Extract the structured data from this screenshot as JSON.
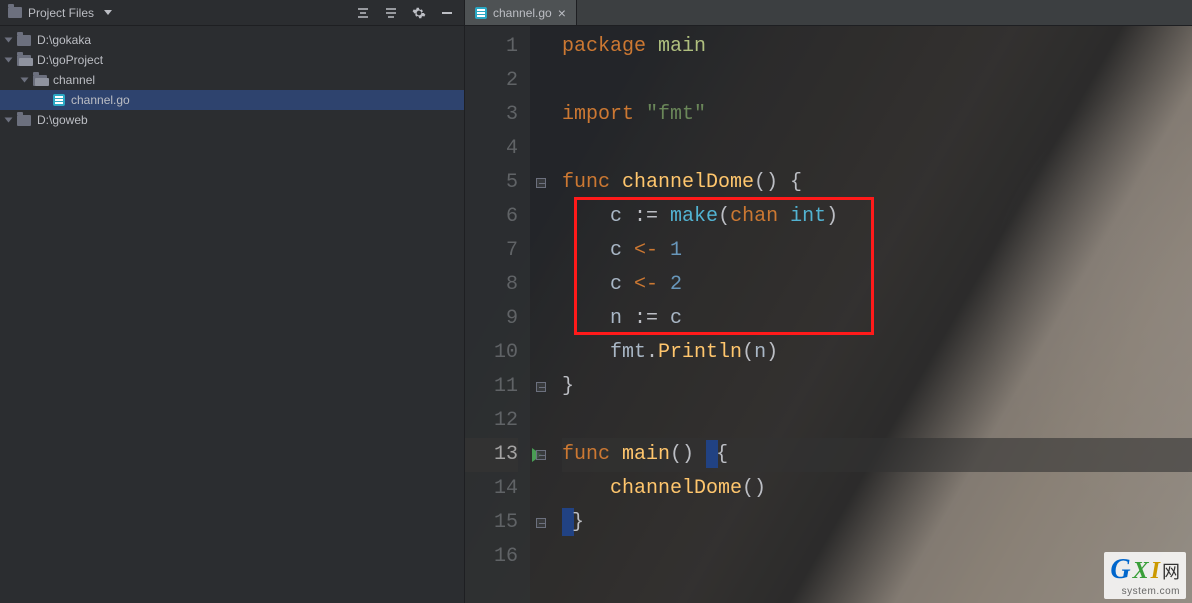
{
  "sidebar": {
    "title": "Project Files",
    "items": [
      {
        "label": "D:\\gokaka",
        "depth": 0,
        "expanded": true,
        "type": "folder",
        "selected": false
      },
      {
        "label": "D:\\goProject",
        "depth": 0,
        "expanded": true,
        "type": "folder-open",
        "selected": false
      },
      {
        "label": "channel",
        "depth": 1,
        "expanded": true,
        "type": "folder-open",
        "selected": false
      },
      {
        "label": "channel.go",
        "depth": 2,
        "expanded": null,
        "type": "go-file",
        "selected": true
      },
      {
        "label": "D:\\goweb",
        "depth": 0,
        "expanded": true,
        "type": "folder",
        "selected": false
      }
    ]
  },
  "tabs": [
    {
      "label": "channel.go",
      "active": true
    }
  ],
  "active_line": 13,
  "code": [
    {
      "n": 1,
      "tokens": [
        {
          "t": "package ",
          "c": "kw"
        },
        {
          "t": "main",
          "c": "pkg"
        }
      ]
    },
    {
      "n": 2,
      "tokens": []
    },
    {
      "n": 3,
      "tokens": [
        {
          "t": "import ",
          "c": "kw"
        },
        {
          "t": "\"fmt\"",
          "c": "str"
        }
      ]
    },
    {
      "n": 4,
      "tokens": []
    },
    {
      "n": 5,
      "tokens": [
        {
          "t": "func ",
          "c": "kw"
        },
        {
          "t": "channelDome",
          "c": "fn"
        },
        {
          "t": "() {",
          "c": "pln"
        }
      ],
      "fold": true
    },
    {
      "n": 6,
      "tokens": [
        {
          "t": "    ",
          "c": "pln"
        },
        {
          "t": "c",
          "c": "ident"
        },
        {
          "t": " := ",
          "c": "pln"
        },
        {
          "t": "make",
          "c": "typ"
        },
        {
          "t": "(",
          "c": "pln"
        },
        {
          "t": "chan ",
          "c": "kw"
        },
        {
          "t": "int",
          "c": "typ"
        },
        {
          "t": ")",
          "c": "pln"
        }
      ]
    },
    {
      "n": 7,
      "tokens": [
        {
          "t": "    ",
          "c": "pln"
        },
        {
          "t": "c",
          "c": "ident"
        },
        {
          "t": " <- ",
          "c": "op"
        },
        {
          "t": "1",
          "c": "num"
        }
      ]
    },
    {
      "n": 8,
      "tokens": [
        {
          "t": "    ",
          "c": "pln"
        },
        {
          "t": "c",
          "c": "ident"
        },
        {
          "t": " <- ",
          "c": "op"
        },
        {
          "t": "2",
          "c": "num"
        }
      ]
    },
    {
      "n": 9,
      "tokens": [
        {
          "t": "    ",
          "c": "pln"
        },
        {
          "t": "n",
          "c": "ident"
        },
        {
          "t": " := ",
          "c": "pln"
        },
        {
          "t": "c",
          "c": "ident"
        }
      ]
    },
    {
      "n": 10,
      "tokens": [
        {
          "t": "    ",
          "c": "pln"
        },
        {
          "t": "fmt",
          "c": "ident"
        },
        {
          "t": ".",
          "c": "pln"
        },
        {
          "t": "Println",
          "c": "fn"
        },
        {
          "t": "(",
          "c": "pln"
        },
        {
          "t": "n",
          "c": "ident"
        },
        {
          "t": ")",
          "c": "pln"
        }
      ]
    },
    {
      "n": 11,
      "tokens": [
        {
          "t": "}",
          "c": "pln"
        }
      ],
      "fold": true
    },
    {
      "n": 12,
      "tokens": []
    },
    {
      "n": 13,
      "tokens": [
        {
          "t": "func ",
          "c": "kw"
        },
        {
          "t": "main",
          "c": "fn"
        },
        {
          "t": "() ",
          "c": "pln"
        },
        {
          "t": "{",
          "c": "pln",
          "caret": true
        }
      ],
      "run": true,
      "fold": true
    },
    {
      "n": 14,
      "tokens": [
        {
          "t": "    ",
          "c": "pln"
        },
        {
          "t": "channelDome",
          "c": "fn"
        },
        {
          "t": "()",
          "c": "pln"
        }
      ]
    },
    {
      "n": 15,
      "tokens": [
        {
          "t": "}",
          "c": "pln",
          "caret": true
        }
      ],
      "fold": true
    },
    {
      "n": 16,
      "tokens": []
    }
  ],
  "highlight_box": {
    "top_line": 6,
    "bottom_line": 9
  },
  "watermark": {
    "brand": "GXI",
    "suffix": "网",
    "sub": "system.com"
  }
}
